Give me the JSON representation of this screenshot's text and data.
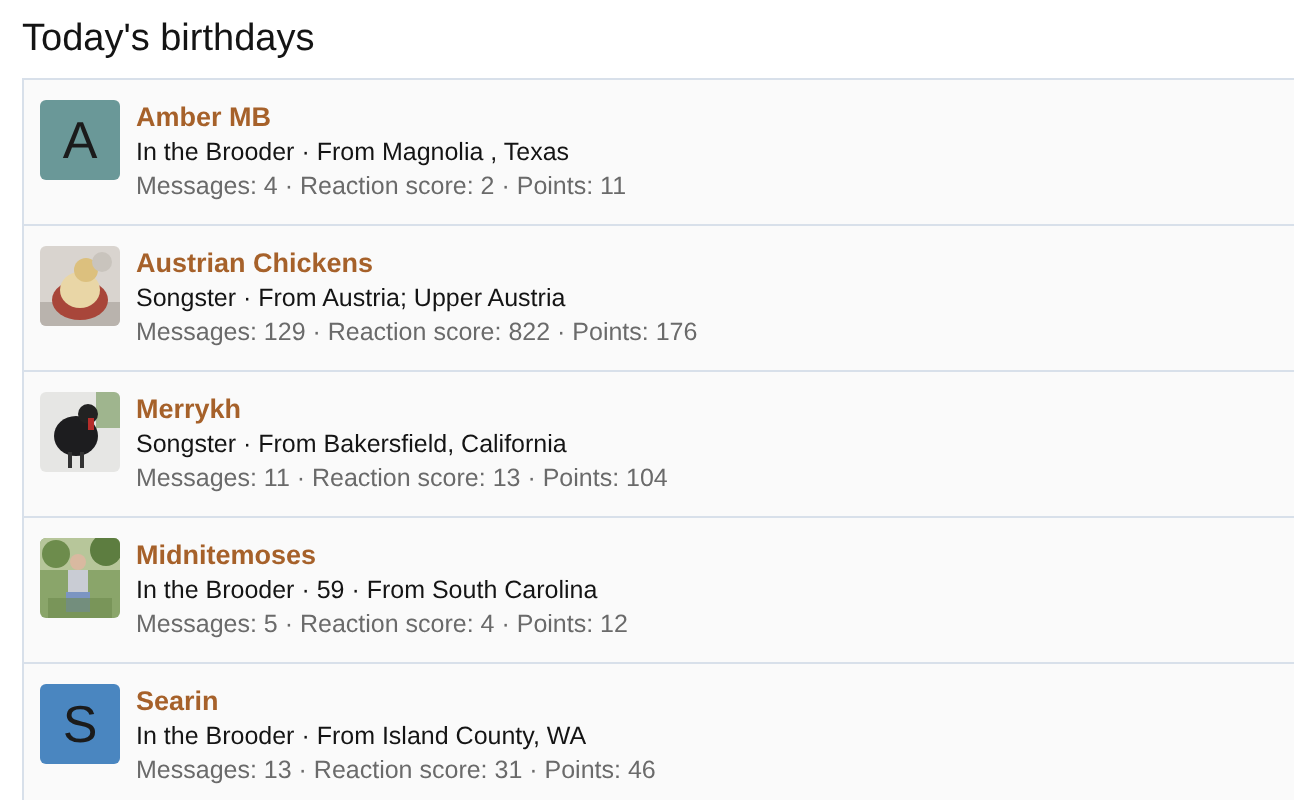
{
  "title": "Today's birthdays",
  "members": [
    {
      "name": "Amber MB",
      "avatar": {
        "kind": "letter",
        "letter": "A",
        "color": "#6a9898"
      },
      "info": "In the Brooder · From Magnolia , Texas",
      "stats": "Messages: 4 · Reaction score: 2 · Points: 11"
    },
    {
      "name": "Austrian Chickens",
      "info": "Songster · From Austria; Upper Austria",
      "stats": "Messages: 129 · Reaction score: 822 · Points: 176"
    },
    {
      "name": "Merrykh",
      "info": "Songster · From Bakersfield, California",
      "stats": "Messages: 11 · Reaction score: 13 · Points: 104"
    },
    {
      "name": "Midnitemoses",
      "info": "In the Brooder · 59 · From South Carolina",
      "stats": "Messages: 5 · Reaction score: 4 · Points: 12"
    },
    {
      "name": "Searin",
      "avatar": {
        "kind": "letter",
        "letter": "S",
        "color": "#4a86c0"
      },
      "info": "In the Brooder · From Island County, WA",
      "stats": "Messages: 13 · Reaction score: 31 · Points: 46"
    }
  ]
}
